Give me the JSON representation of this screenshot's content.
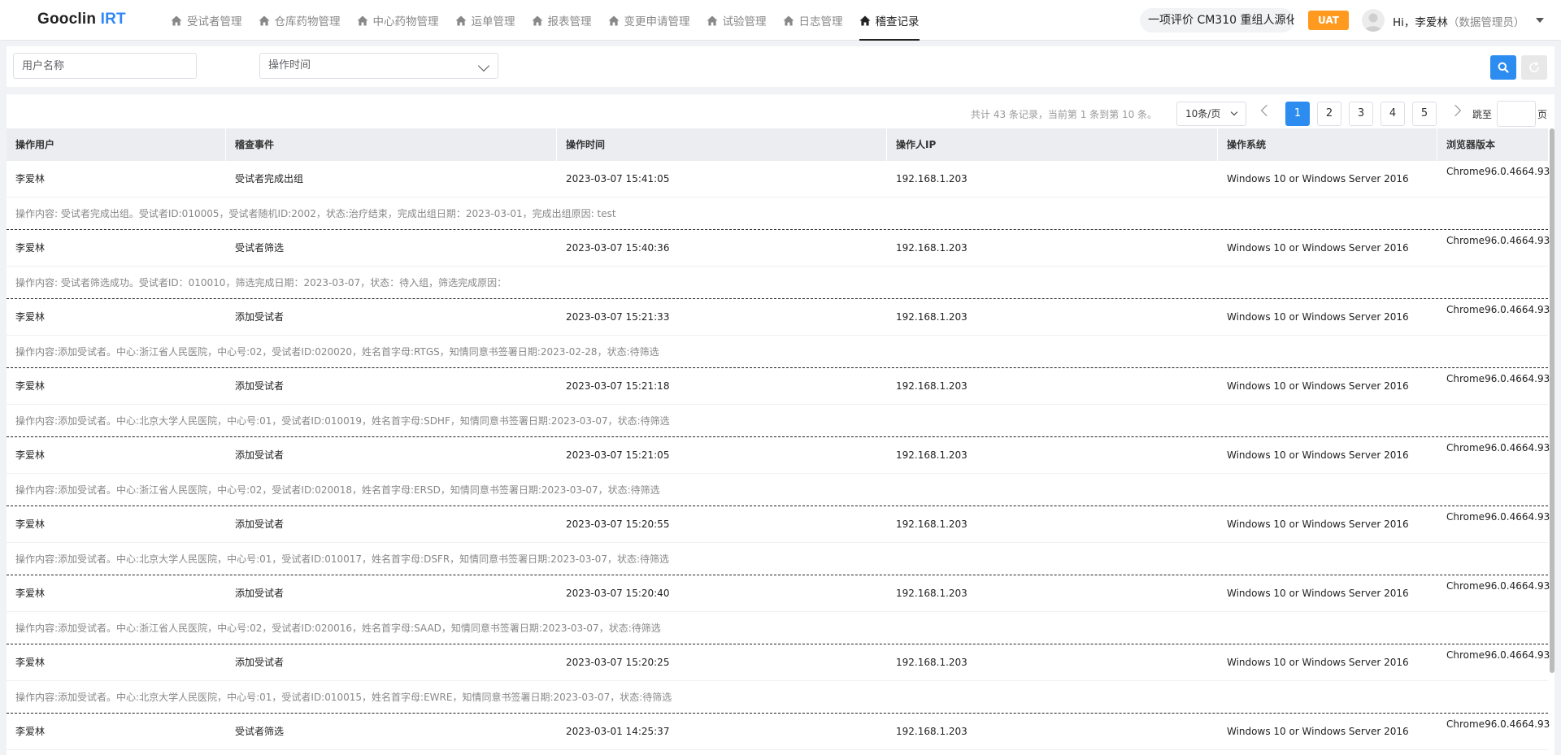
{
  "header": {
    "logo_main": "Gooclin ",
    "logo_accent": "IRT",
    "nav": [
      {
        "label": "受试者管理",
        "active": false
      },
      {
        "label": "仓库药物管理",
        "active": false
      },
      {
        "label": "中心药物管理",
        "active": false
      },
      {
        "label": "运单管理",
        "active": false
      },
      {
        "label": "报表管理",
        "active": false
      },
      {
        "label": "变更申请管理",
        "active": false
      },
      {
        "label": "试验管理",
        "active": false
      },
      {
        "label": "日志管理",
        "active": false
      },
      {
        "label": "稽查记录",
        "active": true
      }
    ],
    "project": "一项评价 CM310 重组人源化",
    "env_badge": "UAT",
    "user_greeting": "Hi，李爱林",
    "user_role": "（数据管理员）"
  },
  "filter": {
    "username_placeholder": "用户名称",
    "op_time_placeholder": "操作时间"
  },
  "pagination": {
    "summary": "共计 43 条记录，当前第 1 条到第  10  条。",
    "page_size": "10条/页",
    "pages": [
      "1",
      "2",
      "3",
      "4",
      "5"
    ],
    "current": "1",
    "jump_label": "跳至",
    "jump_suffix": "页"
  },
  "table": {
    "columns": [
      "操作用户",
      "稽查事件",
      "操作时间",
      "操作人IP",
      "操作系统",
      "浏览器版本"
    ],
    "rows": [
      {
        "user": "李爱林",
        "event": "受试者完成出组",
        "time": "2023-03-07 15:41:05",
        "ip": "192.168.1.203",
        "os": "Windows 10 or Windows Server 2016",
        "browser": "Chrome96.0.4664.93",
        "detail": "操作内容: 受试者完成出组。受试者ID:010005，受试者随机ID:2002，状态:治疗结束，完成出组日期：2023-03-01，完成出组原因: test"
      },
      {
        "user": "李爱林",
        "event": "受试者筛选",
        "time": "2023-03-07 15:40:36",
        "ip": "192.168.1.203",
        "os": "Windows 10 or Windows Server 2016",
        "browser": "Chrome96.0.4664.93",
        "detail": "操作内容: 受试者筛选成功。受试者ID：010010，筛选完成日期：2023-03-07，状态：待入组，筛选完成原因："
      },
      {
        "user": "李爱林",
        "event": "添加受试者",
        "time": "2023-03-07 15:21:33",
        "ip": "192.168.1.203",
        "os": "Windows 10 or Windows Server 2016",
        "browser": "Chrome96.0.4664.93",
        "detail": "操作内容:添加受试者。中心:浙江省人民医院，中心号:02，受试者ID:020020，姓名首字母:RTGS，知情同意书签署日期:2023-02-28，状态:待筛选"
      },
      {
        "user": "李爱林",
        "event": "添加受试者",
        "time": "2023-03-07 15:21:18",
        "ip": "192.168.1.203",
        "os": "Windows 10 or Windows Server 2016",
        "browser": "Chrome96.0.4664.93",
        "detail": "操作内容:添加受试者。中心:北京大学人民医院，中心号:01，受试者ID:010019，姓名首字母:SDHF，知情同意书签署日期:2023-03-07，状态:待筛选"
      },
      {
        "user": "李爱林",
        "event": "添加受试者",
        "time": "2023-03-07 15:21:05",
        "ip": "192.168.1.203",
        "os": "Windows 10 or Windows Server 2016",
        "browser": "Chrome96.0.4664.93",
        "detail": "操作内容:添加受试者。中心:浙江省人民医院，中心号:02，受试者ID:020018，姓名首字母:ERSD，知情同意书签署日期:2023-03-07，状态:待筛选"
      },
      {
        "user": "李爱林",
        "event": "添加受试者",
        "time": "2023-03-07 15:20:55",
        "ip": "192.168.1.203",
        "os": "Windows 10 or Windows Server 2016",
        "browser": "Chrome96.0.4664.93",
        "detail": "操作内容:添加受试者。中心:北京大学人民医院，中心号:01，受试者ID:010017，姓名首字母:DSFR，知情同意书签署日期:2023-03-07，状态:待筛选"
      },
      {
        "user": "李爱林",
        "event": "添加受试者",
        "time": "2023-03-07 15:20:40",
        "ip": "192.168.1.203",
        "os": "Windows 10 or Windows Server 2016",
        "browser": "Chrome96.0.4664.93",
        "detail": "操作内容:添加受试者。中心:浙江省人民医院，中心号:02，受试者ID:020016，姓名首字母:SAAD，知情同意书签署日期:2023-03-07，状态:待筛选"
      },
      {
        "user": "李爱林",
        "event": "添加受试者",
        "time": "2023-03-07 15:20:25",
        "ip": "192.168.1.203",
        "os": "Windows 10 or Windows Server 2016",
        "browser": "Chrome96.0.4664.93",
        "detail": "操作内容:添加受试者。中心:北京大学人民医院，中心号:01，受试者ID:010015，姓名首字母:EWRE，知情同意书签署日期:2023-03-07，状态:待筛选"
      },
      {
        "user": "李爱林",
        "event": "受试者筛选",
        "time": "2023-03-01 14:25:37",
        "ip": "192.168.1.203",
        "os": "Windows 10 or Windows Server 2016",
        "browser": "Chrome96.0.4664.93",
        "detail": ""
      }
    ]
  },
  "colors": {
    "accent": "#2d8cf0",
    "uat": "#ff9a1f",
    "header_bg": "#ebedf1"
  }
}
